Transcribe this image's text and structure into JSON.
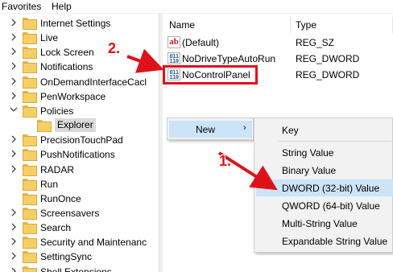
{
  "menubar": {
    "items": [
      "Favorites",
      "Help"
    ]
  },
  "tree": {
    "items": [
      {
        "label": "Internet Settings",
        "expander": "collapsed"
      },
      {
        "label": "Live",
        "expander": "collapsed"
      },
      {
        "label": "Lock Screen",
        "expander": "collapsed"
      },
      {
        "label": "Notifications",
        "expander": "collapsed"
      },
      {
        "label": "OnDemandInterfaceCacl",
        "expander": "collapsed"
      },
      {
        "label": "PenWorkspace",
        "expander": "collapsed"
      },
      {
        "label": "Policies",
        "expander": "expanded"
      },
      {
        "label": "Explorer",
        "expander": "none",
        "selected": true
      },
      {
        "label": "PrecisionTouchPad",
        "expander": "collapsed"
      },
      {
        "label": "PushNotifications",
        "expander": "collapsed"
      },
      {
        "label": "RADAR",
        "expander": "collapsed"
      },
      {
        "label": "Run",
        "expander": "none"
      },
      {
        "label": "RunOnce",
        "expander": "none"
      },
      {
        "label": "Screensavers",
        "expander": "collapsed"
      },
      {
        "label": "Search",
        "expander": "collapsed"
      },
      {
        "label": "Security and Maintenanc",
        "expander": "collapsed"
      },
      {
        "label": "SettingSync",
        "expander": "collapsed"
      },
      {
        "label": "Shell Extensions",
        "expander": "collapsed"
      }
    ]
  },
  "values": {
    "headers": {
      "name": "Name",
      "type": "Type"
    },
    "rows": [
      {
        "icon": "string-value-icon",
        "glyph": "ab",
        "name": "(Default)",
        "type": "REG_SZ"
      },
      {
        "icon": "binary-value-icon",
        "glyph": "011\n110",
        "name": "NoDriveTypeAutoRun",
        "type": "REG_DWORD"
      },
      {
        "icon": "binary-value-icon",
        "glyph": "011\n110",
        "name": "NoControlPanel",
        "type": "REG_DWORD"
      }
    ]
  },
  "context_menu": {
    "new_label": "New",
    "new_arrow": "›",
    "submenu": [
      "Key",
      "String Value",
      "Binary Value",
      "DWORD (32-bit) Value",
      "QWORD (64-bit) Value",
      "Multi-String Value",
      "Expandable String Value"
    ],
    "active_item": "DWORD (32-bit) Value"
  },
  "annotations": {
    "step1": "1.",
    "step2": "2.",
    "color": "#e0101a"
  }
}
